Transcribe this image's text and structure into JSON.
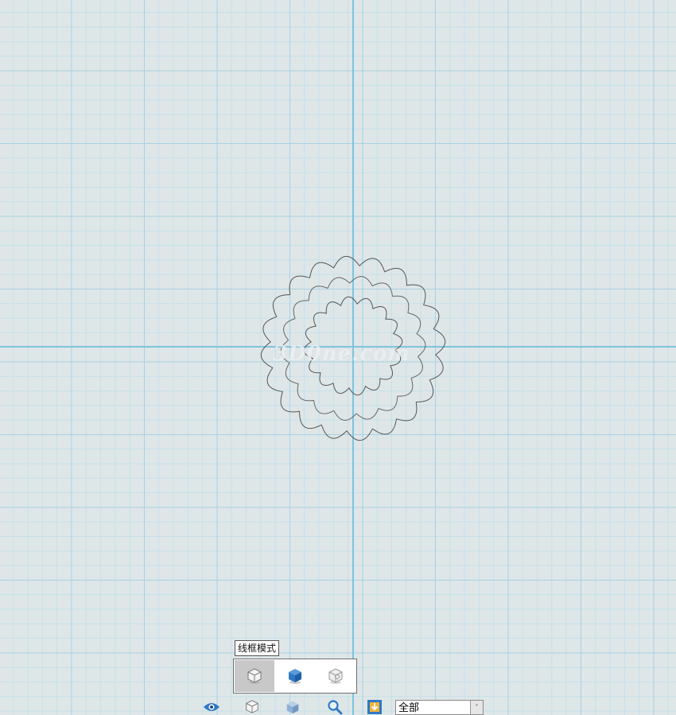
{
  "watermark": "3D0ne.com",
  "tooltip": "线框模式",
  "render_modes": [
    {
      "name": "wireframe",
      "icon": "wireframe-cube-icon",
      "active": true
    },
    {
      "name": "shaded",
      "icon": "shaded-cube-icon",
      "active": false
    },
    {
      "name": "transparent",
      "icon": "transparent-cube-icon",
      "active": false
    }
  ],
  "toolbar": {
    "icons": [
      "eye-icon",
      "wireframe-cube-icon",
      "shaded-cube-icon",
      "magnifier-icon",
      "import-icon"
    ],
    "filter_value": "全部",
    "filter_arrow": "˅"
  },
  "colors": {
    "background": "#dfe6e7",
    "grid_major": "#a8d2e2",
    "grid_minor": "#c3e1eb",
    "axis": "#7fc3dd",
    "model_stroke": "#555555",
    "accent_blue": "#2f79c4"
  }
}
